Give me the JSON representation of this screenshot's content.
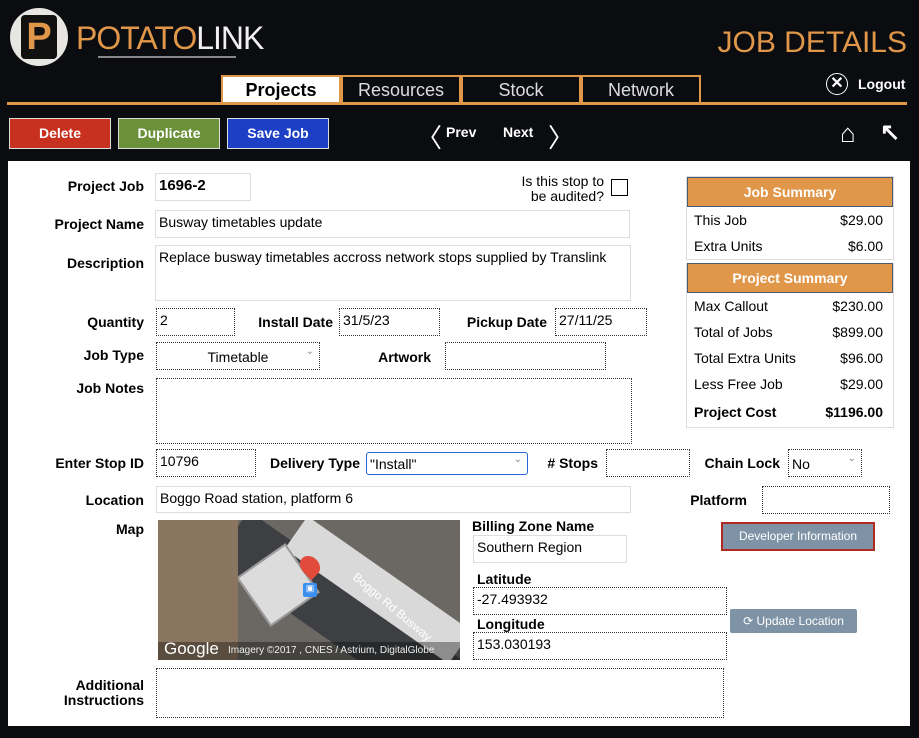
{
  "header": {
    "logo_left": "POTATO",
    "logo_right": "LINK",
    "logo_letter": "P",
    "title": "JOB DETAILS",
    "logout": "Logout"
  },
  "tabs": [
    {
      "label": "Projects",
      "active": true
    },
    {
      "label": "Resources"
    },
    {
      "label": "Stock"
    },
    {
      "label": "Network"
    }
  ],
  "toolbar": {
    "delete": "Delete",
    "duplicate": "Duplicate",
    "save": "Save Job",
    "prev": "Prev",
    "next": "Next",
    "colors": {
      "delete": "#c8311f",
      "duplicate": "#6a913a",
      "save": "#1c3fc6"
    }
  },
  "form": {
    "project_job_label": "Project Job",
    "project_job": "1696-2",
    "audit_label1": "Is this stop to",
    "audit_label2": "be audited?",
    "audited": false,
    "project_name_label": "Project Name",
    "project_name": "Busway timetables update",
    "description_label": "Description",
    "description": "Replace busway timetables accross network stops supplied by Translink",
    "quantity_label": "Quantity",
    "quantity": "2",
    "install_date_label": "Install Date",
    "install_date": "31/5/23",
    "pickup_date_label": "Pickup Date",
    "pickup_date": "27/11/25",
    "job_type_label": "Job Type",
    "job_type": "Timetable",
    "artwork_label": "Artwork",
    "artwork": "",
    "job_notes_label": "Job Notes",
    "job_notes": "",
    "stop_id_label": "Enter Stop ID",
    "stop_id": "10796",
    "delivery_type_label": "Delivery Type",
    "delivery_type": "\"Install\"",
    "stops_label": "# Stops",
    "stops": "",
    "chain_lock_label": "Chain Lock",
    "chain_lock": "No",
    "location_label": "Location",
    "location": "Boggo Road station, platform 6",
    "platform_label": "Platform",
    "platform": "",
    "map_label": "Map",
    "map_road": "Boggo Rd Busway",
    "map_logo": "Google",
    "map_attr": "Imagery ©2017 , CNES / Astrium, DigitalGlobe",
    "billing_zone_label": "Billing Zone Name",
    "billing_zone": "Southern Region",
    "latitude_label": "Latitude",
    "latitude": "-27.493932",
    "longitude_label": "Longitude",
    "longitude": "153.030193",
    "developer_info": "Developer Information",
    "update_location": "Update Location",
    "additional_label1": "Additional",
    "additional_label2": "Instructions",
    "additional": ""
  },
  "job_summary": {
    "title": "Job Summary",
    "rows": [
      {
        "label": "This Job",
        "value": "$29.00"
      },
      {
        "label": "Extra Units",
        "value": "$6.00"
      }
    ]
  },
  "project_summary": {
    "title": "Project  Summary",
    "rows": [
      {
        "label": "Max Callout",
        "value": "$230.00"
      },
      {
        "label": "Total of Jobs",
        "value": "$899.00"
      },
      {
        "label": "Total Extra Units",
        "value": "$96.00"
      },
      {
        "label": "Less Free Job",
        "value": "$29.00"
      },
      {
        "label": "Project Cost",
        "value": "$1196.00"
      }
    ]
  }
}
